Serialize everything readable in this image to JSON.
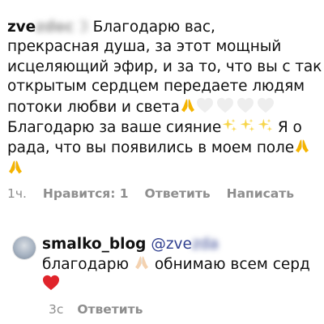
{
  "comment": {
    "username": "zve",
    "username_blurred": "zdec",
    "extra_blurred": "3",
    "line1": "Благодарю вас,",
    "line2": "прекрасная душа, за этот мощный",
    "line3": "исцеляющий эфир, и за то, что вы с так",
    "line4": "открытым сердцем передаете людям",
    "line5": "потоки любви и света",
    "line6": "Благодарю за ваше сияние",
    "line6_tail": "Я о",
    "line7": "рада, что вы появились в моем поле"
  },
  "comment_meta": {
    "time": "1ч.",
    "likes": "Нравится: 1",
    "reply": "Ответить",
    "message": "Написать"
  },
  "reply": {
    "username": "smalko_blog",
    "mention": "@zve",
    "mention_blurred": "zda",
    "line1_a": "благодарю",
    "line1_b": "обнимаю всем серд"
  },
  "reply_meta": {
    "time": "3с",
    "reply": "Ответить"
  },
  "emoji": {
    "hands": "folded-hands",
    "white_heart": "white-heart",
    "sparkles": "sparkles",
    "red_heart": "red-heart"
  },
  "colors": {
    "text": "#111111",
    "meta": "#8e8e8e",
    "mention": "#2f3f8f",
    "hands_yellow": "#f5b400",
    "red_heart": "#e0242b"
  }
}
